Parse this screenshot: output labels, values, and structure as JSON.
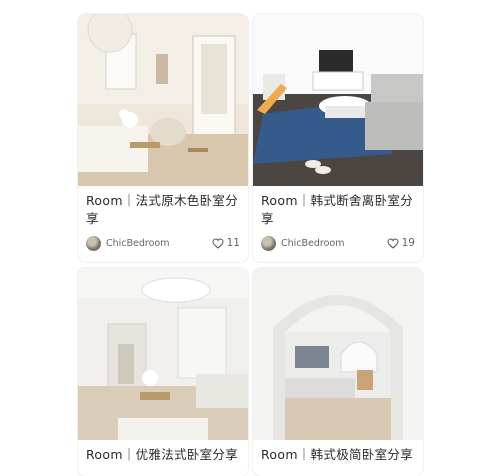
{
  "cards": [
    {
      "title": "Room｜法式原木色卧室分享",
      "author": "ChicBedroom",
      "likes": "11"
    },
    {
      "title": "Room｜韩式断舍离卧室分享",
      "author": "ChicBedroom",
      "likes": "19"
    },
    {
      "title": "Room｜优雅法式卧室分享"
    },
    {
      "title": "Room｜韩式极简卧室分享"
    }
  ],
  "icons": {
    "like": "heart-outline-icon",
    "avatar": "user-avatar-icon"
  }
}
